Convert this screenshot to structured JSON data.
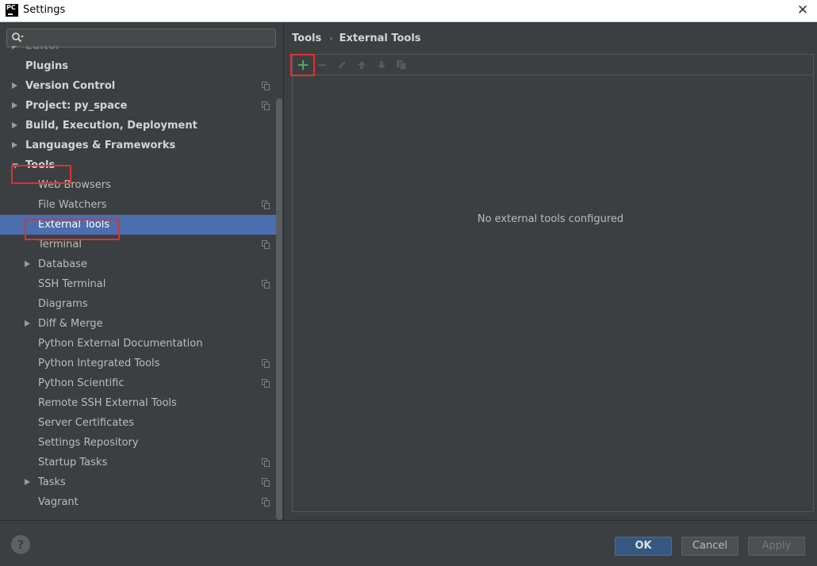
{
  "window": {
    "app_icon_text": "PC",
    "title": "Settings",
    "close_glyph": "✕"
  },
  "sidebar": {
    "search_placeholder": "",
    "items": [
      {
        "label": "Editor",
        "level": 0,
        "bold": true,
        "arrow": "right",
        "faded": true
      },
      {
        "label": "Plugins",
        "level": 0,
        "bold": true,
        "arrow": null
      },
      {
        "label": "Version Control",
        "level": 0,
        "bold": true,
        "arrow": "right",
        "project_icon": true
      },
      {
        "label": "Project: py_space",
        "level": 0,
        "bold": true,
        "arrow": "right",
        "project_icon": true
      },
      {
        "label": "Build, Execution, Deployment",
        "level": 0,
        "bold": true,
        "arrow": "right"
      },
      {
        "label": "Languages & Frameworks",
        "level": 0,
        "bold": true,
        "arrow": "right"
      },
      {
        "label": "Tools",
        "level": 0,
        "bold": true,
        "arrow": "down",
        "highlighted": true
      },
      {
        "label": "Web Browsers",
        "level": 1
      },
      {
        "label": "File Watchers",
        "level": 1,
        "project_icon": true
      },
      {
        "label": "External Tools",
        "level": 1,
        "selected": true,
        "highlighted": true
      },
      {
        "label": "Terminal",
        "level": 1,
        "project_icon": true
      },
      {
        "label": "Database",
        "level": 1,
        "arrow": "right"
      },
      {
        "label": "SSH Terminal",
        "level": 1,
        "project_icon": true
      },
      {
        "label": "Diagrams",
        "level": 1
      },
      {
        "label": "Diff & Merge",
        "level": 1,
        "arrow": "right"
      },
      {
        "label": "Python External Documentation",
        "level": 1
      },
      {
        "label": "Python Integrated Tools",
        "level": 1,
        "project_icon": true
      },
      {
        "label": "Python Scientific",
        "level": 1,
        "project_icon": true
      },
      {
        "label": "Remote SSH External Tools",
        "level": 1
      },
      {
        "label": "Server Certificates",
        "level": 1
      },
      {
        "label": "Settings Repository",
        "level": 1
      },
      {
        "label": "Startup Tasks",
        "level": 1,
        "project_icon": true
      },
      {
        "label": "Tasks",
        "level": 1,
        "arrow": "right",
        "project_icon": true
      },
      {
        "label": "Vagrant",
        "level": 1,
        "project_icon": true
      }
    ]
  },
  "main": {
    "breadcrumb": [
      "Tools",
      "External Tools"
    ],
    "breadcrumb_separator": "›",
    "toolbar": [
      {
        "name": "add-icon",
        "enabled": true,
        "highlighted": true
      },
      {
        "name": "remove-icon",
        "enabled": false
      },
      {
        "name": "edit-icon",
        "enabled": false
      },
      {
        "name": "move-up-icon",
        "enabled": false
      },
      {
        "name": "move-down-icon",
        "enabled": false
      },
      {
        "name": "copy-icon",
        "enabled": false
      }
    ],
    "empty_text": "No external tools configured"
  },
  "footer": {
    "help_label": "?",
    "ok_label": "OK",
    "cancel_label": "Cancel",
    "apply_label": "Apply"
  },
  "colors": {
    "background": "#3c3f41",
    "selection": "#4b6eaf",
    "highlight_box": "#e03030",
    "add_icon": "#59a869",
    "ok_button": "#365880"
  }
}
